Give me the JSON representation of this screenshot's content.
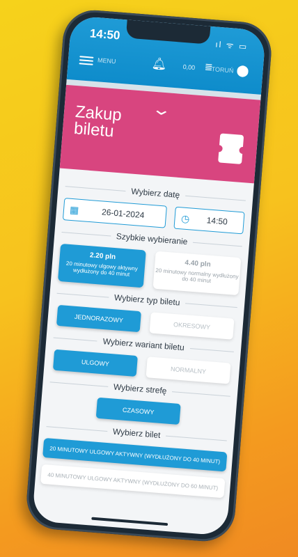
{
  "status": {
    "time": "14:50",
    "icons": "ıl ᯤ ▭"
  },
  "topbar": {
    "menu_label": "MENU",
    "balance": "0,00",
    "city": "TORUŃ"
  },
  "hero": {
    "title_line1": "Zakup",
    "title_line2": "biletu"
  },
  "date_section": {
    "title": "Wybierz datę",
    "date_value": "26-01-2024",
    "time_value": "14:50"
  },
  "quick_section": {
    "title": "Szybkie wybieranie",
    "options": [
      {
        "price": "2.20 pln",
        "desc": "20 minutowy ulgowy aktywny wydłużony do 40 minut"
      },
      {
        "price": "4.40 pln",
        "desc": "20 minutowy normalny wydłużony do 40 minut"
      }
    ]
  },
  "type_section": {
    "title": "Wybierz typ biletu",
    "options": [
      "JEDNORAZOWY",
      "OKRESOWY"
    ]
  },
  "variant_section": {
    "title": "Wybierz wariant biletu",
    "options": [
      "ULGOWY",
      "NORMALNY"
    ]
  },
  "zone_section": {
    "title": "Wybierz strefę",
    "option": "CZASOWY"
  },
  "ticket_section": {
    "title": "Wybierz bilet",
    "options": [
      "20 MINUTOWY ULGOWY AKTYWNY (WYDŁUŻONY DO 40 MINUT)",
      "40 MINUTOWY ULGOWY AKTYWNY (WYDŁUŻONY DO 60 MINUT)"
    ]
  },
  "colors": {
    "accent": "#1f9bd6",
    "hero": "#d8457f",
    "background_top": "#f6d21b",
    "background_bottom": "#f08a22"
  }
}
